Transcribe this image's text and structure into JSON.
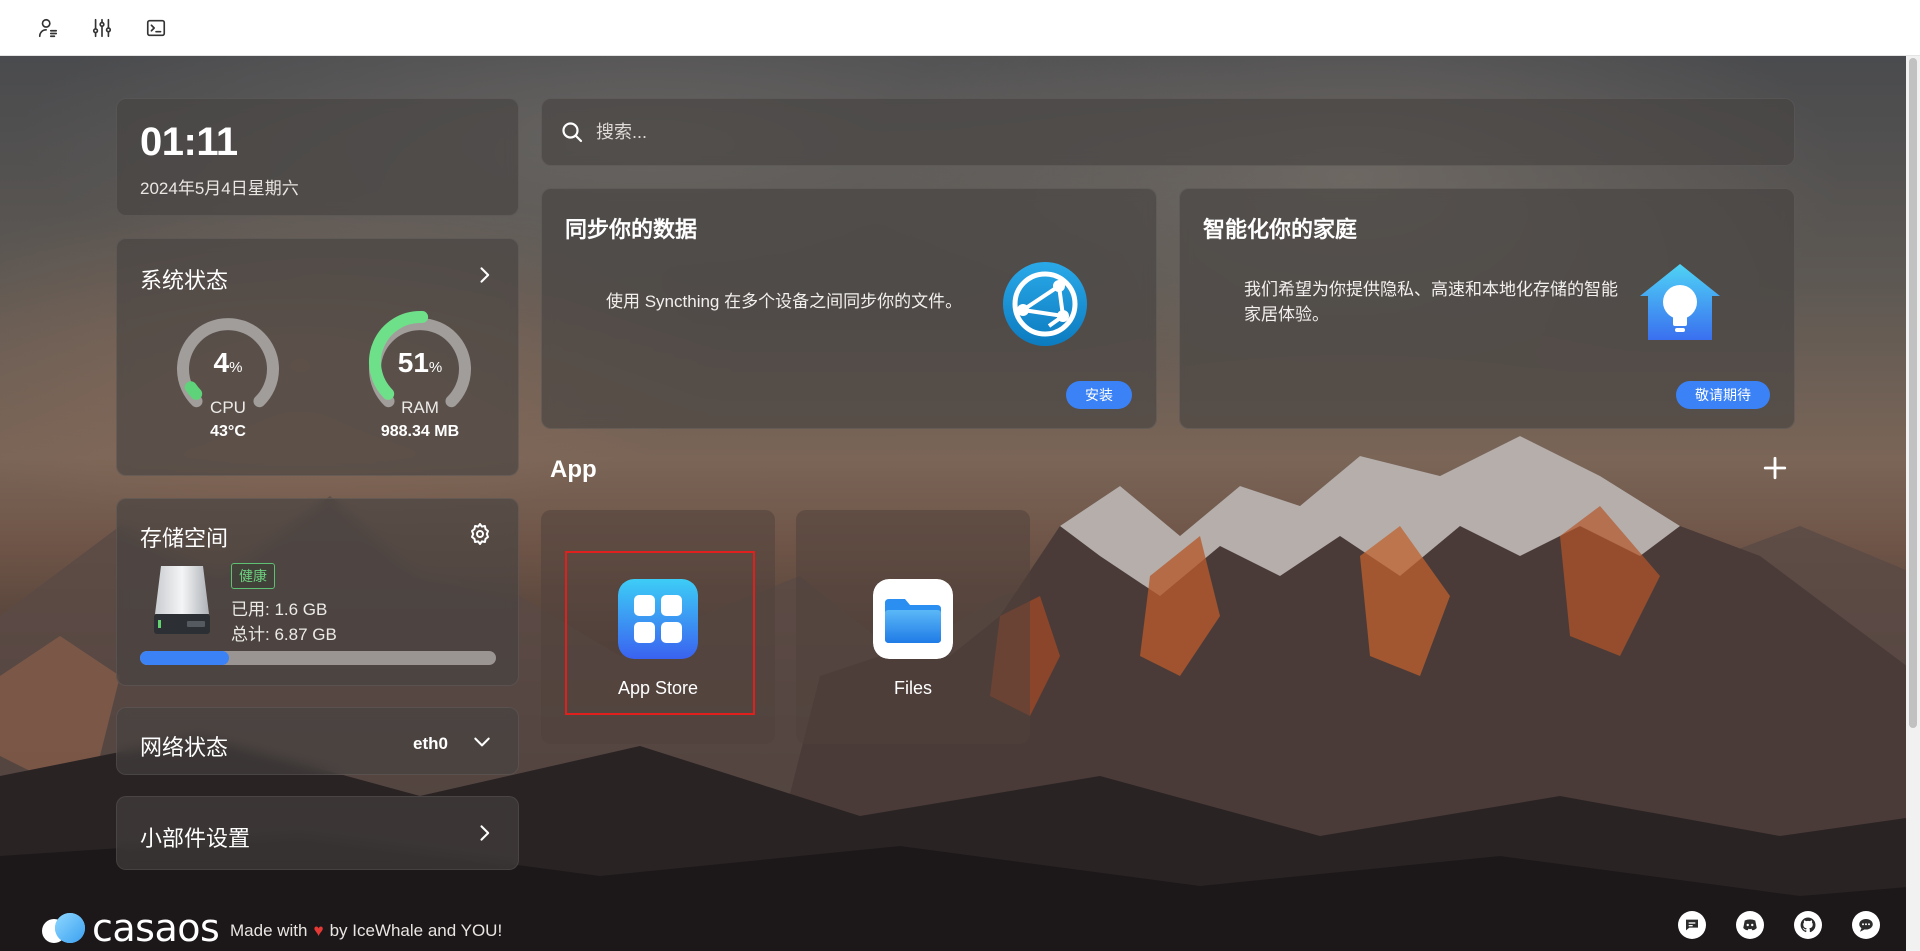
{
  "topbar": {
    "icons": [
      "user-settings-icon",
      "sliders-icon",
      "terminal-icon"
    ]
  },
  "clock": {
    "time": "01:11",
    "date": "2024年5月4日星期六"
  },
  "system_status": {
    "title": "系统状态",
    "cpu": {
      "value": "4",
      "unit": "%",
      "label": "CPU",
      "temp": "43°C",
      "fraction": 0.04,
      "color": "#5fd37a"
    },
    "ram": {
      "value": "51",
      "unit": "%",
      "label": "RAM",
      "used": "988.34 MB",
      "fraction": 0.51,
      "color": "#6fe08a"
    }
  },
  "storage": {
    "title": "存储空间",
    "health": "健康",
    "used": "已用: 1.6 GB",
    "total": "总计: 6.87 GB",
    "fraction": 0.25,
    "bar_color": "#3b82f6"
  },
  "network": {
    "title": "网络状态",
    "interface": "eth0"
  },
  "widgets": {
    "title": "小部件设置"
  },
  "search": {
    "placeholder": "搜索..."
  },
  "promos": [
    {
      "title": "同步你的数据",
      "text": "使用 Syncthing 在多个设备之间同步你的文件。",
      "button": "安装",
      "icon": "syncthing-icon"
    },
    {
      "title": "智能化你的家庭",
      "text": "我们希望为你提供隐私、高速和本地化存储的智能家居体验。",
      "button": "敬请期待",
      "icon": "smart-home-icon"
    }
  ],
  "apps": {
    "heading": "App",
    "items": [
      {
        "label": "App Store",
        "icon": "app-store-icon"
      },
      {
        "label": "Files",
        "icon": "files-icon"
      }
    ]
  },
  "footer": {
    "logo": "casaos",
    "made_with": "Made with",
    "by": "by IceWhale and YOU!",
    "icons": [
      "feedback-icon",
      "discord-icon",
      "github-icon",
      "chat-icon"
    ]
  },
  "colors": {
    "accent": "#3b82f6",
    "highlight": "#e0201c",
    "health": "#6ed07f",
    "heart": "#e53935"
  }
}
